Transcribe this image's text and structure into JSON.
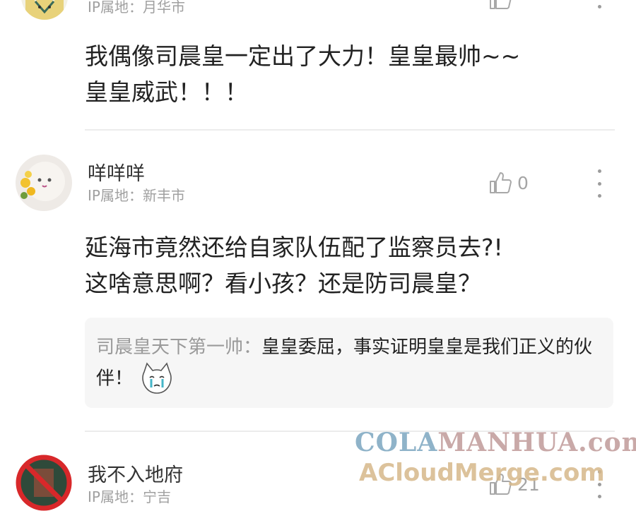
{
  "comments": [
    {
      "username": "",
      "ip_label": "IP属地：月华市",
      "likes": "",
      "text_line1": "我偶像司晨皇一定出了大力！皇皇最帅~~",
      "text_line2": "皇皇威武！！！"
    },
    {
      "username": "咩咩咩",
      "ip_label": "IP属地：新丰市",
      "likes": "0",
      "text_line1": "延海市竟然还给自家队伍配了监察员去?!",
      "text_line2": "这啥意思啊？看小孩？还是防司晨皇？",
      "reply": {
        "author": "司晨皇天下第一帅：",
        "text": "皇皇委屈，事实证明皇皇是我们正义的伙伴！"
      }
    },
    {
      "username": "我不入地府",
      "ip_label": "IP属地：宁吉",
      "likes": "21"
    }
  ],
  "watermark": {
    "line1_a": "COLA",
    "line1_b": "MANHUA.com",
    "line2": "ACloudMerge.com"
  },
  "colors": {
    "text": "#222222",
    "muted": "#a0a0a0",
    "reply_bg": "#f6f6f6",
    "divider": "#ececec"
  }
}
